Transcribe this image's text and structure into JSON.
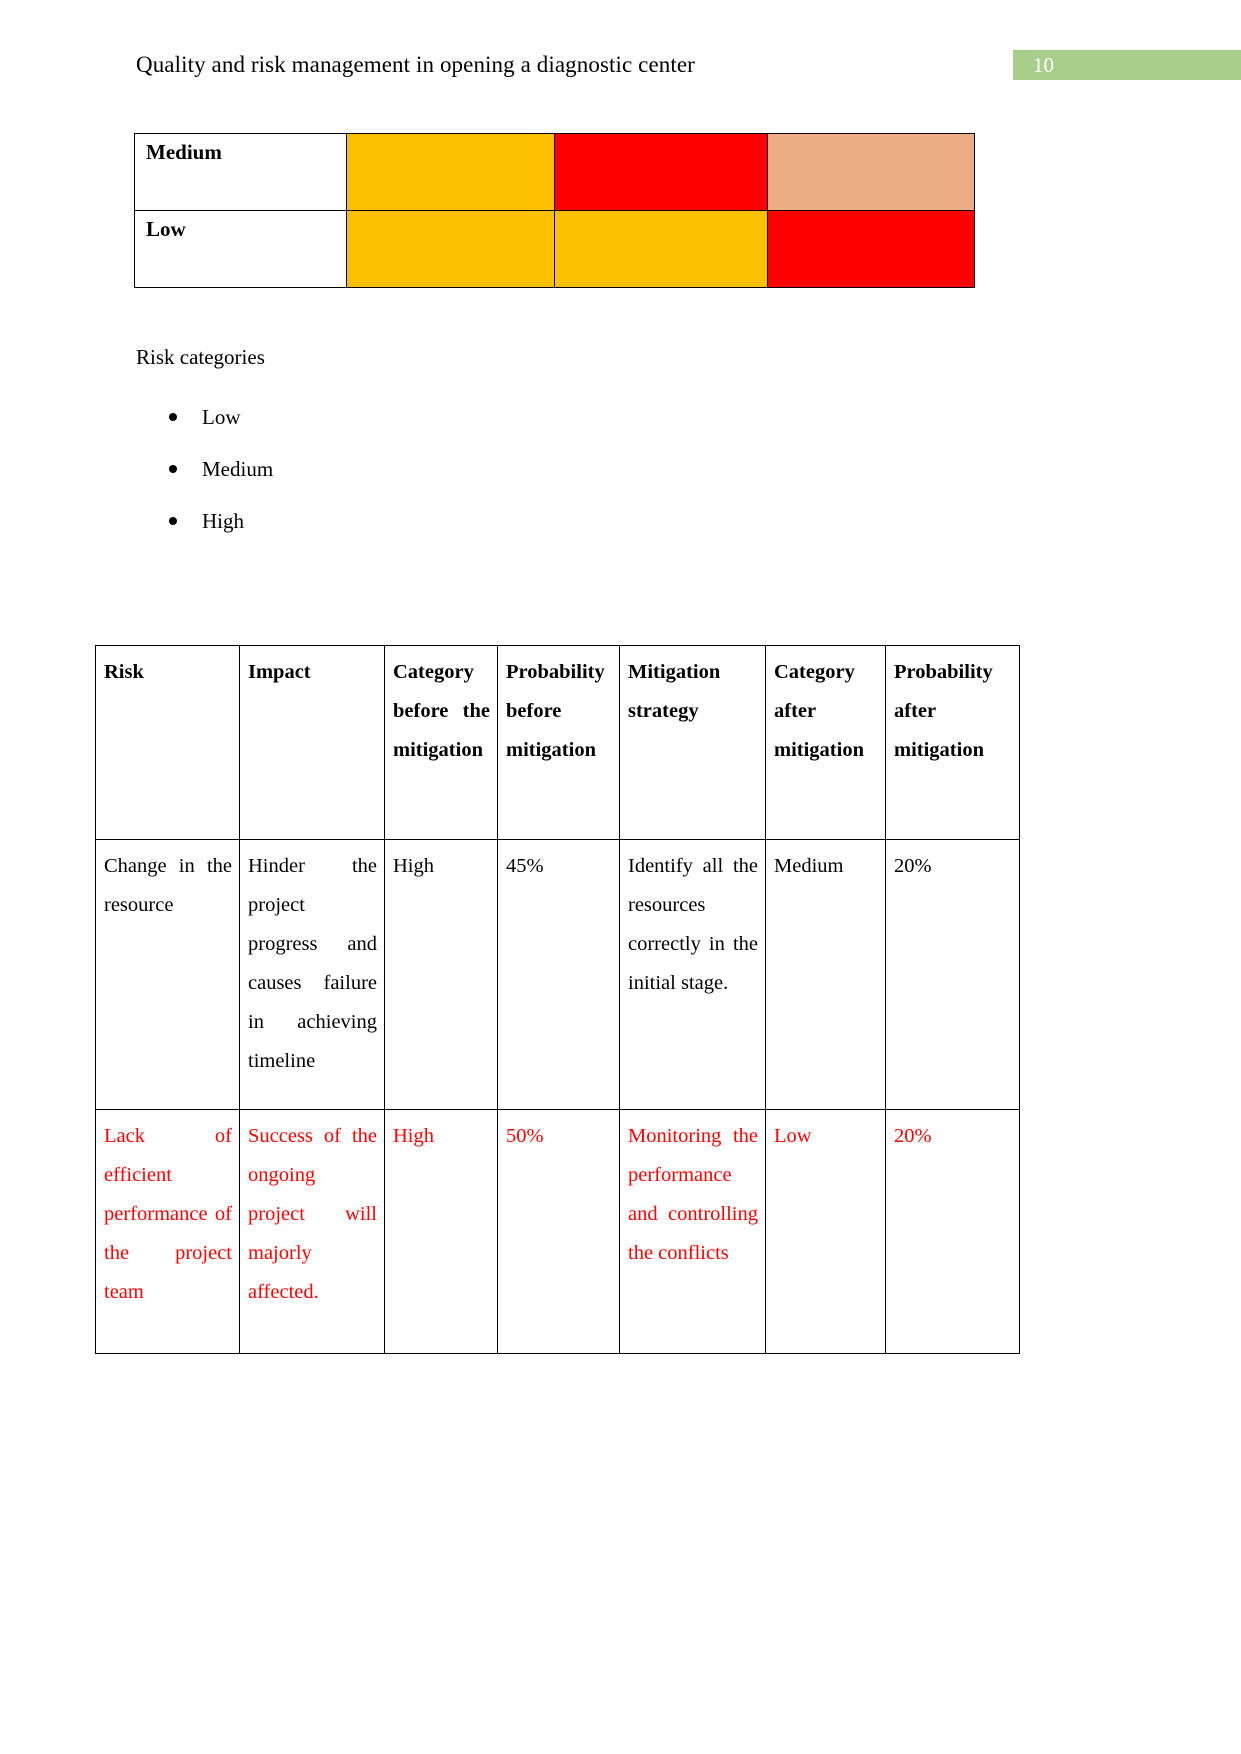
{
  "header": {
    "title": "Quality and risk management in opening a diagnostic center",
    "page_number": "10",
    "badge_color": "#A8CE8C"
  },
  "risk_matrix": {
    "colors": {
      "amber": "#FCC000",
      "red": "#FF0000",
      "peach": "#EDAD82",
      "white": "#FFFFFF"
    },
    "rows": [
      {
        "label": "Medium",
        "cells": [
          "amber",
          "red",
          "peach"
        ]
      },
      {
        "label": "Low",
        "cells": [
          "amber",
          "amber",
          "red"
        ]
      }
    ]
  },
  "risk_categories": {
    "heading": "Risk categories",
    "items": [
      "Low",
      "Medium",
      "High"
    ]
  },
  "risk_table": {
    "headers": [
      "Risk",
      "Impact",
      "Category before the mitigation",
      "Probability before mitigation",
      "Mitigation strategy",
      "Category after mitigation",
      "Probability after mitigation"
    ],
    "rows": [
      {
        "color": "#000000",
        "cells": [
          "Change in the resource",
          "Hinder the project progress and causes failure in achieving timeline",
          "High",
          "45%",
          "Identify all the resources correctly in the initial stage.",
          "Medium",
          "20%"
        ]
      },
      {
        "color": "#FF0000",
        "cells": [
          "Lack of efficient performance of the project team",
          "Success of the ongoing project will majorly affected.",
          "High",
          "50%",
          "Monitoring the performance and controlling the conflicts",
          "Low",
          "20%"
        ]
      }
    ]
  }
}
